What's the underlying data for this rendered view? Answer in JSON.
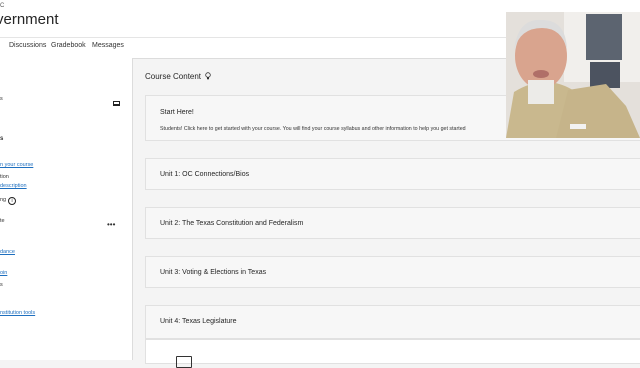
{
  "header": {
    "kicker": "C",
    "course_title": "vernment"
  },
  "tabs": [
    {
      "label": "Discussions"
    },
    {
      "label": "Gradebook"
    },
    {
      "label": "Messages"
    }
  ],
  "sidebar": {
    "items": [
      {
        "label": "s"
      },
      {
        "label": "s"
      },
      {
        "label": "n your course"
      },
      {
        "label": "tion"
      },
      {
        "label": "description"
      },
      {
        "label": "ng"
      },
      {
        "label": "te"
      },
      {
        "label": "dance"
      },
      {
        "label": "oin"
      },
      {
        "label": "s"
      },
      {
        "label": "nstitution tools"
      }
    ]
  },
  "main": {
    "section_title": "Course Content",
    "modules": [
      {
        "title": "Start Here!",
        "description": "Students! Click here to get started with your course. You will find your course syllabus and other information to help you get started"
      },
      {
        "title": "Unit 1: OC Connections/Bios"
      },
      {
        "title": "Unit 2: The Texas Constitution and Federalism"
      },
      {
        "title": "Unit 3: Voting & Elections in Texas"
      },
      {
        "title": "Unit 4: Texas Legislature"
      }
    ]
  },
  "colors": {
    "link": "#1e6fbf",
    "background": "#f4f4f4",
    "module_bg": "#f7f7f7"
  }
}
